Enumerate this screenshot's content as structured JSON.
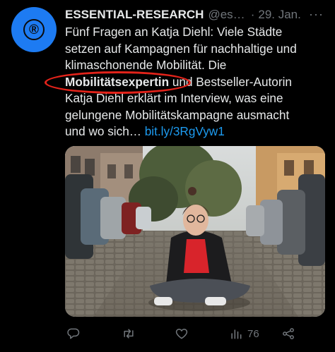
{
  "tweet": {
    "account_name": "ESSENTIAL-RESEARCH",
    "handle": "@es…",
    "separator": "·",
    "date": "29. Jan.",
    "more_label": "···",
    "avatar_symbol": "®",
    "text": {
      "line1": "Fünf Fragen an Katja Diehl: Viele Städte",
      "line2": "setzen auf Kampagnen für nachhaltige und",
      "line3": "klimaschonende Mobilität. Die",
      "line4_bold": "Mobilitätsexpertin",
      "line4_rest": " und Bestseller-Autorin",
      "line5": "Katja Diehl erklärt im Interview, was eine",
      "line6": "gelungene Mobilitätskampagne ausmacht",
      "line7_text": "und wo sich… ",
      "line7_link": "bit.ly/3RgVyw1"
    },
    "highlight_color": "#e3231a",
    "link_color": "#1d9bf0",
    "avatar_color": "#1d7bf2"
  },
  "actions": {
    "reply_icon": "reply-icon",
    "retweet_icon": "retweet-icon",
    "like_icon": "heart-icon",
    "views_icon": "views-chart-icon",
    "views_count": "76",
    "share_icon": "share-icon"
  }
}
